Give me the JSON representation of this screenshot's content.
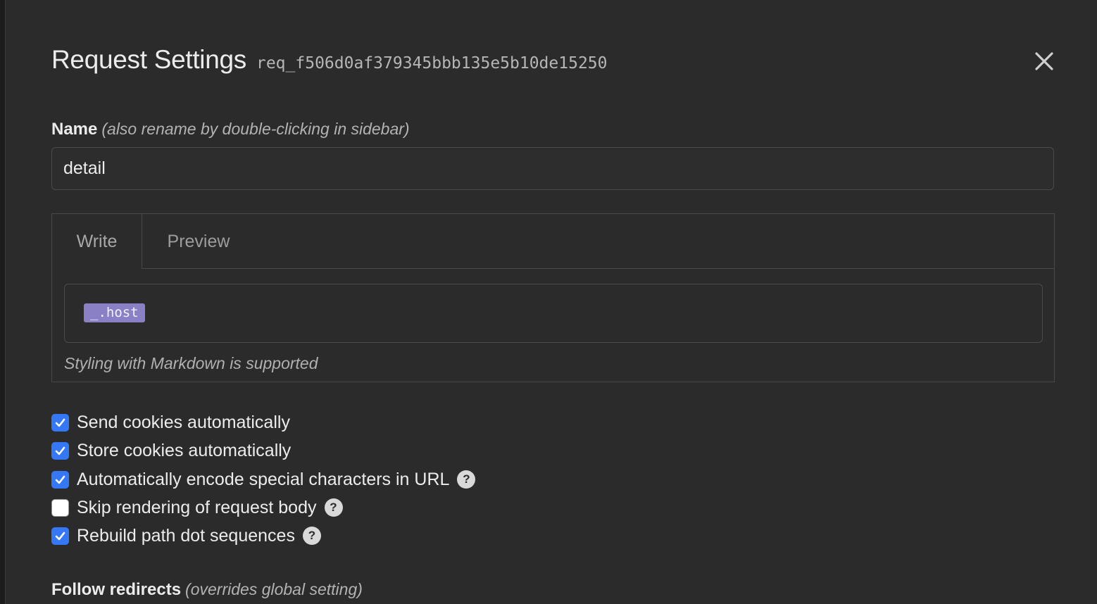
{
  "header": {
    "title": "Request Settings",
    "request_id": "req_f506d0af379345bbb135e5b10de15250",
    "close_icon": "close-icon"
  },
  "name": {
    "label": "Name",
    "hint": "(also rename by double-clicking in sidebar)",
    "value": "detail"
  },
  "description": {
    "tabs": [
      {
        "label": "Write",
        "active": true
      },
      {
        "label": "Preview",
        "active": false
      }
    ],
    "variable_tag": "_.host",
    "markdown_hint": "Styling with Markdown is supported"
  },
  "options": [
    {
      "label": "Send cookies automatically",
      "checked": true,
      "help": false
    },
    {
      "label": "Store cookies automatically",
      "checked": true,
      "help": false
    },
    {
      "label": "Automatically encode special characters in URL",
      "checked": true,
      "help": true
    },
    {
      "label": "Skip rendering of request body",
      "checked": false,
      "help": true
    },
    {
      "label": "Rebuild path dot sequences",
      "checked": true,
      "help": true
    }
  ],
  "help_glyph": "?",
  "follow_redirects": {
    "label": "Follow redirects",
    "hint": "(overrides global setting)"
  },
  "colors": {
    "accent": "#3478f6",
    "variable_tag": "#8a80c6",
    "background": "#2b2b2b"
  }
}
